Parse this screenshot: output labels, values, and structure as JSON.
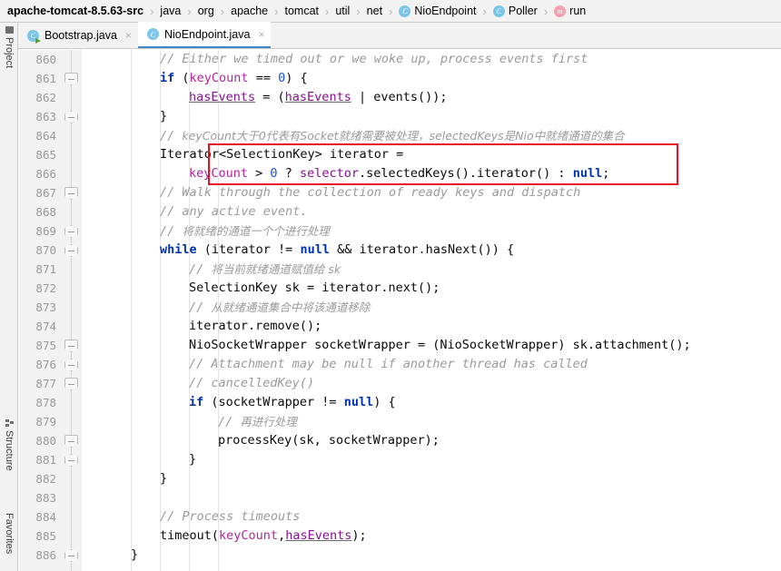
{
  "breadcrumb": {
    "items": [
      {
        "label": "apache-tomcat-8.5.63-src",
        "icon": "",
        "root": true
      },
      {
        "label": "java",
        "icon": ""
      },
      {
        "label": "org",
        "icon": ""
      },
      {
        "label": "apache",
        "icon": ""
      },
      {
        "label": "tomcat",
        "icon": ""
      },
      {
        "label": "util",
        "icon": ""
      },
      {
        "label": "net",
        "icon": ""
      },
      {
        "label": "NioEndpoint",
        "icon": "class-icon",
        "badge": "C"
      },
      {
        "label": "Poller",
        "icon": "class-icon",
        "badge": "C"
      },
      {
        "label": "run",
        "icon": "method-icon",
        "badge": "m"
      }
    ],
    "separator": "›"
  },
  "tabs": [
    {
      "label": "Bootstrap.java",
      "icon": "runnable-class-icon",
      "badge": "C",
      "close": "×",
      "active": false
    },
    {
      "label": "NioEndpoint.java",
      "icon": "class-icon",
      "badge": "C",
      "close": "×",
      "active": true
    }
  ],
  "tool_rail": [
    {
      "label": "Project",
      "icon": "project-icon"
    },
    {
      "label": "Structure",
      "icon": "structure-icon"
    },
    {
      "label": "Favorites",
      "icon": ""
    }
  ],
  "editor": {
    "first_line": 860,
    "line_numbers": [
      860,
      861,
      862,
      863,
      864,
      865,
      866,
      867,
      868,
      869,
      870,
      871,
      872,
      873,
      874,
      875,
      876,
      877,
      878,
      879,
      880,
      881,
      882,
      883,
      884,
      885,
      886
    ],
    "fold_lines": [
      861,
      863,
      867,
      869,
      870,
      875,
      876,
      877,
      880,
      881,
      886
    ],
    "highlight_color": "#e81123",
    "highlighted_lines": [
      865,
      866
    ],
    "lines": [
      {
        "n": 860,
        "indent": 2,
        "html": "<span class=\"cmt\">// Either we timed out or we woke up, process events first</span>"
      },
      {
        "n": 861,
        "indent": 2,
        "html": "<span class=\"kw\">if</span> (<span class=\"par\">keyCount</span> == <span class=\"num\">0</span>) {"
      },
      {
        "n": 862,
        "indent": 3,
        "html": "<span class=\"fld uline\">hasEvents</span> = (<span class=\"fld uline\">hasEvents</span> | events());"
      },
      {
        "n": 863,
        "indent": 2,
        "html": "}"
      },
      {
        "n": 864,
        "indent": 2,
        "html": "<span class=\"cmt\">// <span class=\"cjk\">keyCount大于0代表有Socket就绪需要被处理，selectedKeys是Nio中就绪通道的集合</span></span>"
      },
      {
        "n": 865,
        "indent": 2,
        "html": "Iterator&lt;SelectionKey&gt; iterator ="
      },
      {
        "n": 866,
        "indent": 3,
        "html": "<span class=\"par\">keyCount</span> &gt; <span class=\"num\">0</span> ? <span class=\"fld\">selector</span>.selectedKeys().iterator() : <span class=\"kw\">null</span>;"
      },
      {
        "n": 867,
        "indent": 2,
        "html": "<span class=\"cmt\">// Walk through the collection of ready keys and dispatch</span>"
      },
      {
        "n": 868,
        "indent": 2,
        "html": "<span class=\"cmt\">// any active event.</span>"
      },
      {
        "n": 869,
        "indent": 2,
        "html": "<span class=\"cmt\">// <span class=\"cjk\">将就绪的通道一个个进行处理</span></span>"
      },
      {
        "n": 870,
        "indent": 2,
        "html": "<span class=\"kw\">while</span> (iterator != <span class=\"kw\">null</span> &amp;&amp; iterator.hasNext()) {"
      },
      {
        "n": 871,
        "indent": 3,
        "html": "<span class=\"cmt\">// <span class=\"cjk\">将当前就绪通道赋值给 sk</span></span>"
      },
      {
        "n": 872,
        "indent": 3,
        "html": "SelectionKey sk = iterator.next();"
      },
      {
        "n": 873,
        "indent": 3,
        "html": "<span class=\"cmt\">// <span class=\"cjk\">从就绪通道集合中将该通道移除</span></span>"
      },
      {
        "n": 874,
        "indent": 3,
        "html": "iterator.remove();"
      },
      {
        "n": 875,
        "indent": 3,
        "html": "NioSocketWrapper socketWrapper = (NioSocketWrapper) sk.attachment();"
      },
      {
        "n": 876,
        "indent": 3,
        "html": "<span class=\"cmt\">// Attachment may be null if another thread has called</span>"
      },
      {
        "n": 877,
        "indent": 3,
        "html": "<span class=\"cmt\">// cancelledKey()</span>"
      },
      {
        "n": 878,
        "indent": 3,
        "html": "<span class=\"kw\">if</span> (socketWrapper != <span class=\"kw\">null</span>) {"
      },
      {
        "n": 879,
        "indent": 4,
        "html": "<span class=\"cmt\">// <span class=\"cjk\">再进行处理</span></span>"
      },
      {
        "n": 880,
        "indent": 4,
        "html": "processKey(sk, socketWrapper);"
      },
      {
        "n": 881,
        "indent": 3,
        "html": "}"
      },
      {
        "n": 882,
        "indent": 2,
        "html": "}"
      },
      {
        "n": 883,
        "indent": 0,
        "html": ""
      },
      {
        "n": 884,
        "indent": 2,
        "html": "<span class=\"cmt\">// Process timeouts</span>"
      },
      {
        "n": 885,
        "indent": 2,
        "html": "timeout(<span class=\"par\">keyCount</span>,<span class=\"fld uline\">hasEvents</span>);"
      },
      {
        "n": 886,
        "indent": 1,
        "html": "}"
      }
    ]
  }
}
